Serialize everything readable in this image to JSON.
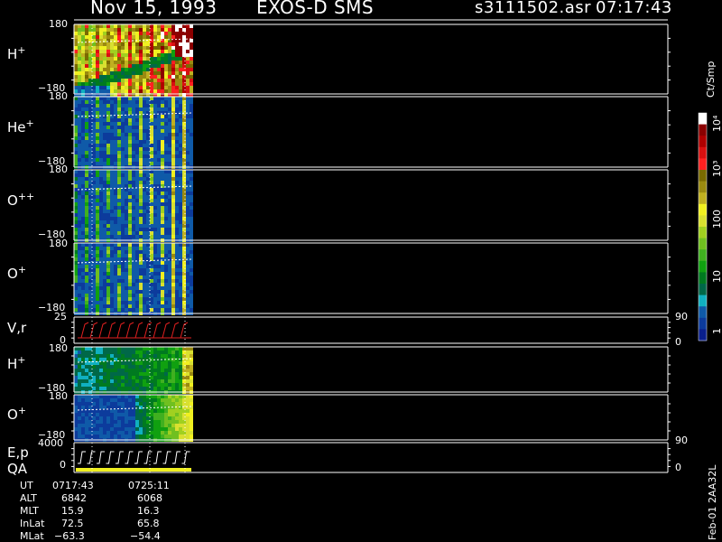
{
  "header": {
    "date": "Nov 15, 1993",
    "instrument": "EXOS-D SMS",
    "filename": "s3111502.asr",
    "time": "07:17:43"
  },
  "panels": [
    {
      "label_main": "H",
      "label_sup": "+",
      "top": "180",
      "bottom": "−180"
    },
    {
      "label_main": "He",
      "label_sup": "+",
      "top": "180",
      "bottom": "−180"
    },
    {
      "label_main": "O",
      "label_sup": "++",
      "top": "180",
      "bottom": "−180"
    },
    {
      "label_main": "O",
      "label_sup": "+",
      "top": "180",
      "bottom": "−180"
    },
    {
      "label_main": "V,r",
      "label_sup": "",
      "top": "25",
      "bottom": "0",
      "right_top": "90",
      "right_bottom": "0"
    },
    {
      "label_main": "H",
      "label_sup": "+",
      "top": "180",
      "bottom": "−180"
    },
    {
      "label_main": "O",
      "label_sup": "+",
      "top": "180",
      "bottom": "−180"
    },
    {
      "label_main": "E,p",
      "label_sub": "QA",
      "top": "4000",
      "bottom": "0",
      "right_top": "90",
      "right_bottom": "0"
    }
  ],
  "colorbar": {
    "unit": "Ct/Smp",
    "labels": [
      "10⁴",
      "10³",
      "100",
      "10",
      "1"
    ],
    "colors": [
      "#ffffff",
      "#8b0000",
      "#b00000",
      "#d81010",
      "#ff2020",
      "#7a6a00",
      "#9a8a10",
      "#c0b020",
      "#f0f020",
      "#d8e030",
      "#a0d020",
      "#70c020",
      "#40b020",
      "#10a010",
      "#007a20",
      "#006848",
      "#10b0c0",
      "#0f5aa8",
      "#0c3b9c",
      "#0a1f8c"
    ]
  },
  "ephemeris": {
    "rows": [
      {
        "label": "UT",
        "v1": "0717:43",
        "v2": "0725:11"
      },
      {
        "label": "ALT",
        "v1": "6842",
        "v2": "6068"
      },
      {
        "label": "MLT",
        "v1": "15.9",
        "v2": "16.3"
      },
      {
        "label": "InLat",
        "v1": "72.5",
        "v2": "65.8"
      },
      {
        "label": "MLat",
        "v1": "−63.3",
        "v2": "−54.4"
      }
    ]
  },
  "footer_id": "Feb-01 2AA32L"
}
